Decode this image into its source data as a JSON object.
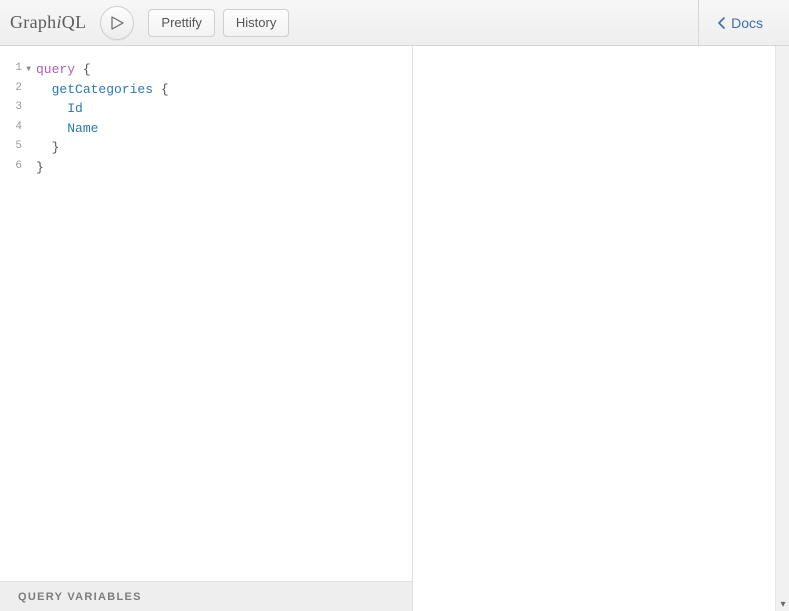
{
  "topbar": {
    "logo_graph": "Graph",
    "logo_i": "i",
    "logo_ql": "QL",
    "prettify_label": "Prettify",
    "history_label": "History",
    "docs_label": "Docs"
  },
  "editor": {
    "lines": [
      {
        "num": "1",
        "tokens": [
          {
            "t": "query",
            "c": "kw"
          },
          {
            "t": " ",
            "c": ""
          },
          {
            "t": "{",
            "c": "punc"
          }
        ],
        "fold": true
      },
      {
        "num": "2",
        "tokens": [
          {
            "t": "  ",
            "c": ""
          },
          {
            "t": "getCategories",
            "c": "field"
          },
          {
            "t": " ",
            "c": ""
          },
          {
            "t": "{",
            "c": "punc"
          }
        ]
      },
      {
        "num": "3",
        "tokens": [
          {
            "t": "    ",
            "c": ""
          },
          {
            "t": "Id",
            "c": "field"
          }
        ]
      },
      {
        "num": "4",
        "tokens": [
          {
            "t": "    ",
            "c": ""
          },
          {
            "t": "Name",
            "c": "field"
          }
        ]
      },
      {
        "num": "5",
        "tokens": [
          {
            "t": "  ",
            "c": ""
          },
          {
            "t": "}",
            "c": "punc"
          }
        ]
      },
      {
        "num": "6",
        "tokens": [
          {
            "t": "}",
            "c": "punc"
          }
        ]
      }
    ]
  },
  "variables_label": "Query Variables"
}
